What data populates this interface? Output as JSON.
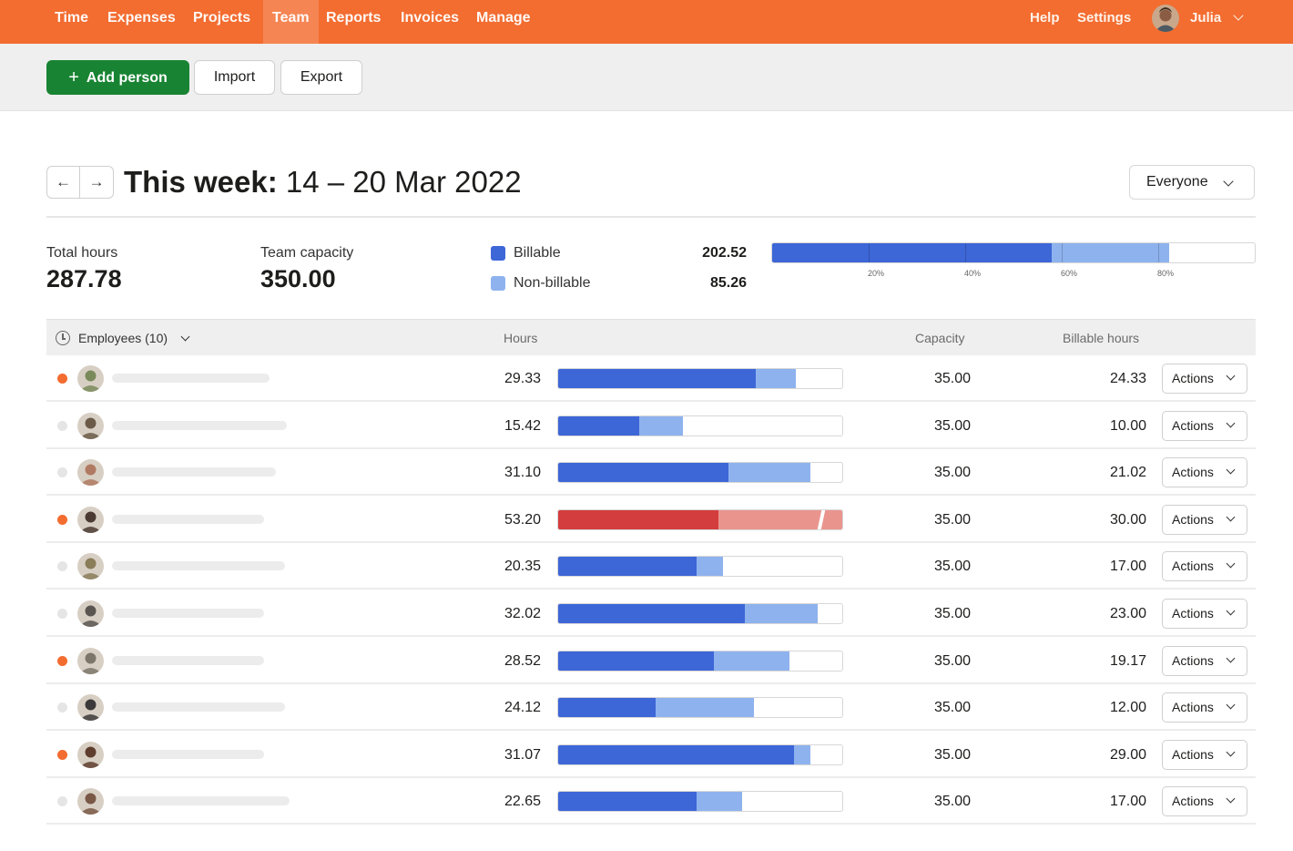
{
  "nav": {
    "items": [
      {
        "label": "Time",
        "active": false
      },
      {
        "label": "Expenses",
        "active": false
      },
      {
        "label": "Projects",
        "active": false
      },
      {
        "label": "Team",
        "active": true
      },
      {
        "label": "Reports",
        "active": false
      },
      {
        "label": "Invoices",
        "active": false
      },
      {
        "label": "Manage",
        "active": false
      }
    ],
    "help": "Help",
    "settings": "Settings",
    "user": "Julia"
  },
  "toolbar": {
    "add_person": "Add person",
    "import": "Import",
    "export": "Export"
  },
  "week": {
    "title_prefix": "This week:",
    "range": "14 – 20 Mar 2022",
    "filter": "Everyone"
  },
  "summary": {
    "total_hours_label": "Total hours",
    "total_hours": "287.78",
    "capacity_label": "Team capacity",
    "capacity": "350.00",
    "billable_label": "Billable",
    "billable": "202.52",
    "nonbillable_label": "Non-billable",
    "nonbillable": "85.26",
    "ticks": [
      "20%",
      "40%",
      "60%",
      "80%"
    ],
    "billable_fraction": 0.5786,
    "nonbillable_fraction": 0.2436
  },
  "colors": {
    "brand": "#f36c30",
    "primary_button": "#188433",
    "billable": "#3d66d7",
    "nonbillable": "#8eb2ee",
    "over_capacity": "#d43d3d",
    "over_capacity_light": "#ea948e"
  },
  "table": {
    "employees_header": "Employees (10)",
    "hours_header": "Hours",
    "capacity_header": "Capacity",
    "billable_header": "Billable hours",
    "action_label": "Actions",
    "rows": [
      {
        "hours": "29.33",
        "capacity": "35.00",
        "billable": "24.33",
        "flag": true,
        "avatar": "#7a8a5a"
      },
      {
        "hours": "15.42",
        "capacity": "35.00",
        "billable": "10.00",
        "flag": false,
        "avatar": "#6b5a48"
      },
      {
        "hours": "31.10",
        "capacity": "35.00",
        "billable": "21.02",
        "flag": false,
        "avatar": "#b07a62"
      },
      {
        "hours": "53.20",
        "capacity": "35.00",
        "billable": "30.00",
        "flag": true,
        "avatar": "#4a3a32"
      },
      {
        "hours": "20.35",
        "capacity": "35.00",
        "billable": "17.00",
        "flag": false,
        "avatar": "#8a7d5a"
      },
      {
        "hours": "32.02",
        "capacity": "35.00",
        "billable": "23.00",
        "flag": false,
        "avatar": "#5a5550"
      },
      {
        "hours": "28.52",
        "capacity": "35.00",
        "billable": "19.17",
        "flag": true,
        "avatar": "#7c756a"
      },
      {
        "hours": "24.12",
        "capacity": "35.00",
        "billable": "12.00",
        "flag": false,
        "avatar": "#3c3a3a"
      },
      {
        "hours": "31.07",
        "capacity": "35.00",
        "billable": "29.00",
        "flag": true,
        "avatar": "#5e3d2e"
      },
      {
        "hours": "22.65",
        "capacity": "35.00",
        "billable": "17.00",
        "flag": false,
        "avatar": "#7a5846"
      }
    ]
  }
}
